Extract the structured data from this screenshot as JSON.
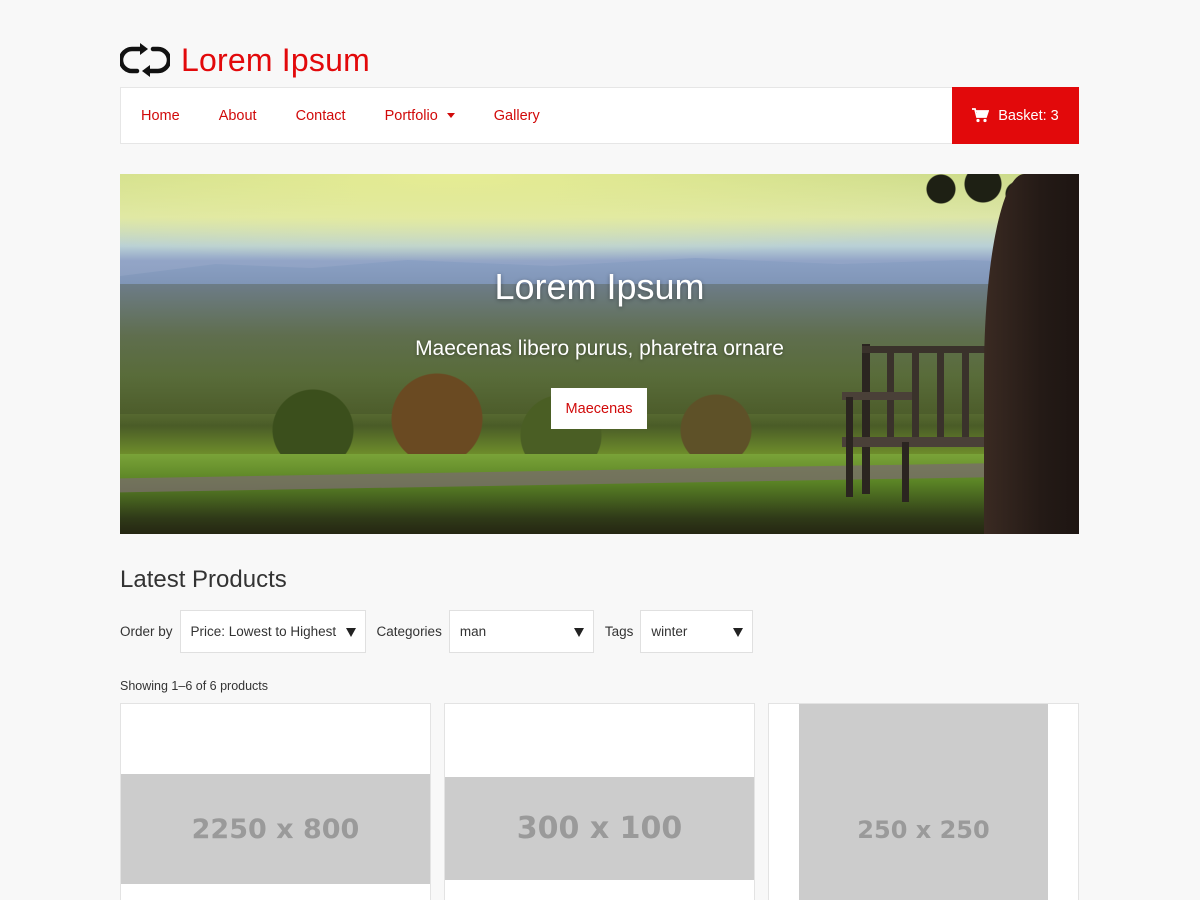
{
  "brand": {
    "name": "Lorem Ipsum",
    "accent": "#e2090b"
  },
  "nav": {
    "items": [
      {
        "label": "Home"
      },
      {
        "label": "About"
      },
      {
        "label": "Contact"
      },
      {
        "label": "Portfolio",
        "has_dropdown": true
      },
      {
        "label": "Gallery"
      }
    ],
    "basket_label": "Basket: 3",
    "basket_icon": "cart-icon"
  },
  "hero": {
    "title": "Lorem Ipsum",
    "subtitle": "Maecenas libero purus, pharetra ornare",
    "button_label": "Maecenas"
  },
  "products": {
    "heading": "Latest Products",
    "filters": {
      "order_label": "Order by",
      "order_value": "Price: Lowest to Highest",
      "categories_label": "Categories",
      "categories_value": "man",
      "tags_label": "Tags",
      "tags_value": "winter"
    },
    "result_count": "Showing 1–6 of 6 products",
    "items": [
      {
        "image_label": "2250 x 800"
      },
      {
        "image_label": "300 x 100"
      },
      {
        "image_label": "250 x 250"
      }
    ]
  }
}
